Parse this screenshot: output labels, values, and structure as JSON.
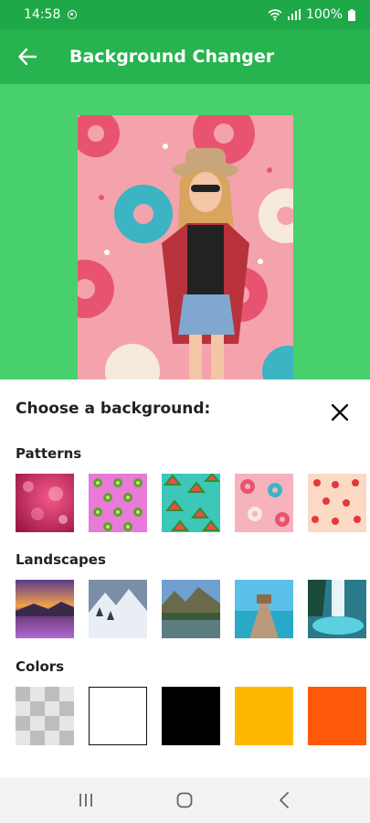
{
  "status": {
    "time": "14:58",
    "battery": "100%"
  },
  "app_bar": {
    "title": "Background Changer"
  },
  "sheet": {
    "title": "Choose a background:",
    "sections": [
      {
        "label": "Patterns",
        "items": [
          "pink-bokeh-pattern",
          "kiwi-pattern",
          "watermelon-pattern",
          "donut-pattern",
          "strawberry-pattern"
        ]
      },
      {
        "label": "Landscapes",
        "items": [
          "lavender-sunset",
          "snowy-mountains",
          "lake-forest",
          "beach-pier",
          "waterfall"
        ]
      },
      {
        "label": "Colors",
        "items": [
          "transparent",
          "#ffffff",
          "#000000",
          "#ffb800",
          "#ff5a0a"
        ]
      }
    ]
  },
  "colors": {
    "status_bar": "#1ea848",
    "app_bar": "#27b34f",
    "preview_bg": "#47d06c"
  }
}
